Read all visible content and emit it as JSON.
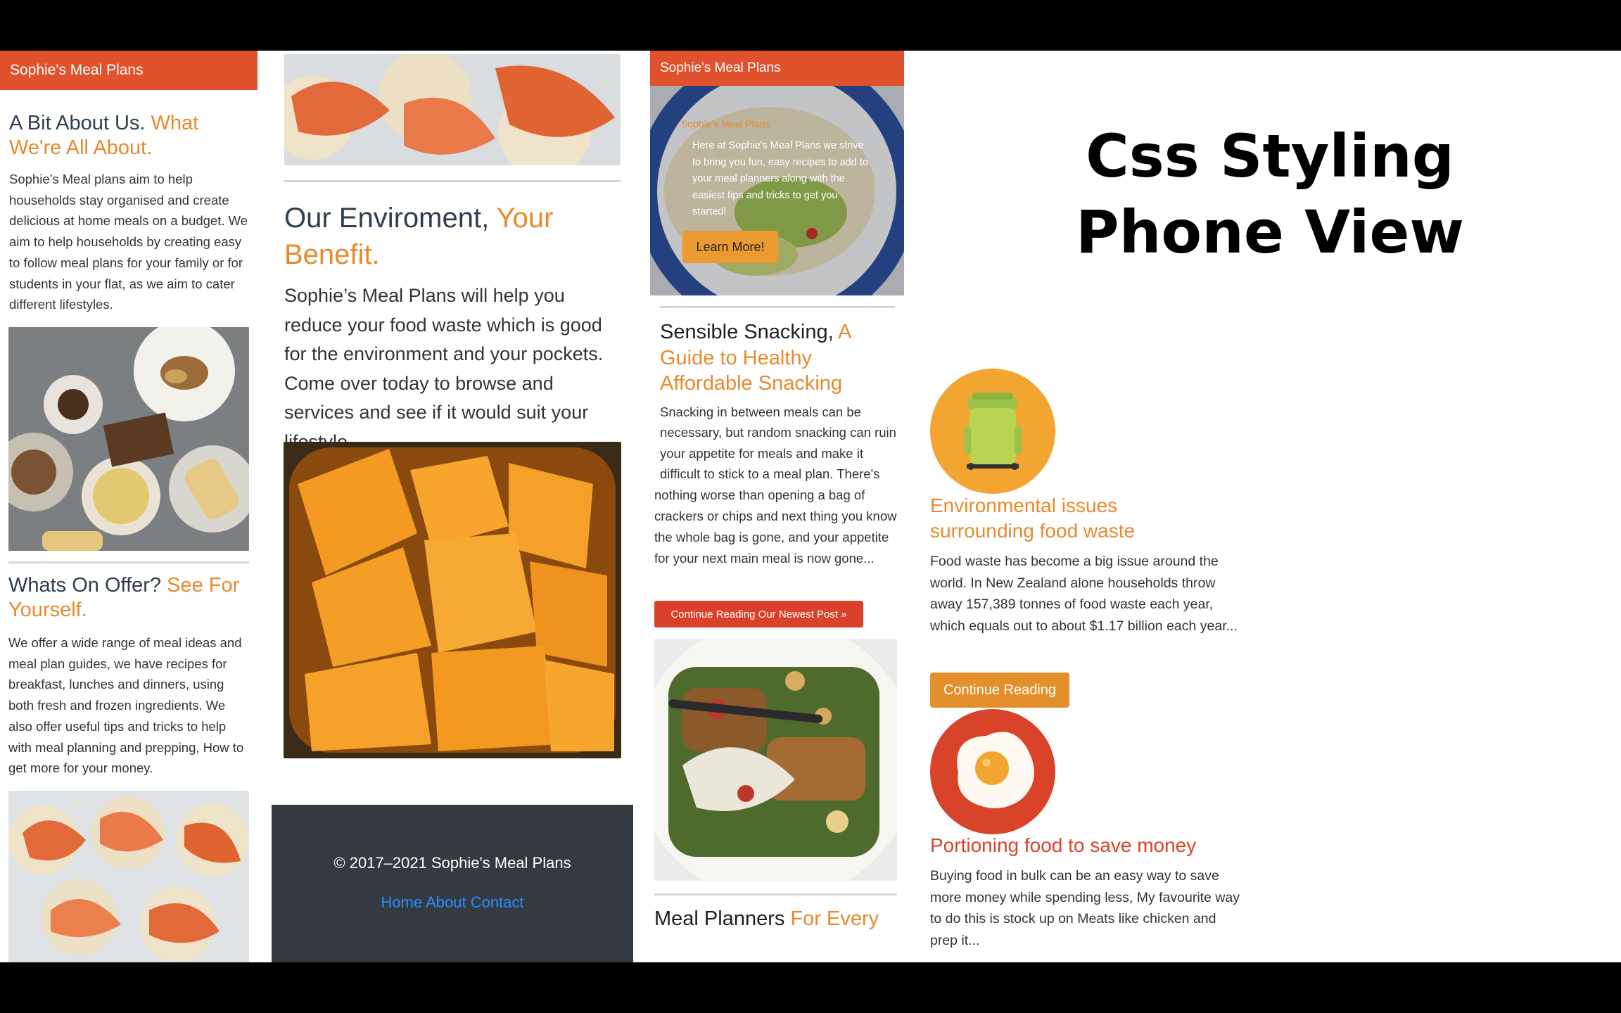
{
  "brand": "Sophie's Meal Plans",
  "panel1": {
    "about_title": "A Bit About Us.",
    "about_accent": "What We're All About.",
    "about_body": "Sophie’s Meal plans aim to help households stay organised and create delicious at home meals on a budget. We aim to help households by creating easy to follow meal plans for your family or for students in your flat, as we aim to cater different lifestyles.",
    "offer_title": "Whats On Offer?",
    "offer_accent": "See For Yourself.",
    "offer_body": "We offer a wide range of meal ideas and meal plan guides, we have recipes for breakfast, lunches and dinners, using both fresh and frozen ingredients. We also offer useful tips and tricks to help with meal planning and prepping, How to get more for your money."
  },
  "panel2": {
    "env_title": "Our Enviroment,",
    "env_accent": "Your Benefit.",
    "env_body": "Sophie’s Meal Plans will help you reduce your food waste which is good for the environment and your pockets. Come over today to browse and services and see if it would suit your lifestyle.",
    "footer_copy": "© 2017–2021 Sophie's Meal Plans",
    "footer_links": [
      "Home",
      "About",
      "Contact"
    ]
  },
  "panel3": {
    "hero_small_title": "Sophie's Meal Plans",
    "hero_text": "Here at Sophie's Meal Plans we strive to bring you fun, easy recipes to add to your meal planners along with the easiest tips and tricks to get you started!",
    "learn_more": "Learn More!",
    "snack_title": "Sensible Snacking,",
    "snack_accent": "A Guide to Healthy Affordable Snacking",
    "snack_body_a": "Snacking in between meals can be necessary, but random snacking can ruin your appetite for meals and make it difficult to stick to a meal plan. There's",
    "snack_body_b": "nothing worse than opening a bag of crackers or chips and next thing you know the whole bag is gone, and your appetite for your next main meal is now gone...",
    "continue_newest": "Continue Reading Our Newest Post »",
    "planners_title": "Meal Planners",
    "planners_accent": "For Every Diet, Every Day, Every"
  },
  "heading": {
    "line1": "Css Styling",
    "line2": "Phone View"
  },
  "panel4": {
    "env_issue_title": "Environmental issues surrounding food waste",
    "env_issue_body": "Food waste has become a big issue around the world. In New Zealand alone households throw away 157,389 tonnes of food waste each year, which equals out to about $1.17 billion each year...",
    "continue_reading": "Continue Reading",
    "portion_title": "Portioning food to save money",
    "portion_body": "Buying food in bulk can be an easy way to save more money while spending less, My favourite way to do this is stock up on Meats like chicken and prep it...",
    "bin_icon": "food-bin-icon",
    "egg_icon": "fried-egg-icon"
  },
  "colors": {
    "brand_red": "#e0522d",
    "accent_orange": "#e8892b",
    "title_navy": "#2c3e50",
    "footer_dark": "#343a40",
    "link_blue": "#2b8cff"
  }
}
